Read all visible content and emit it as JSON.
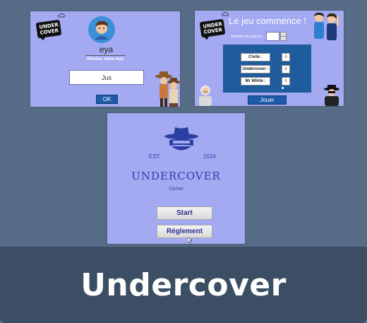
{
  "window1": {
    "logo_text": "UNDER COVER",
    "player_name": "eya",
    "prompt": "Révélez votre mot",
    "word_value": "Jus",
    "ok_label": "OK"
  },
  "window2": {
    "logo_text": "UNDER COVER",
    "heading": "Le jeu commence !",
    "players_label": "Nombre de joueurs :",
    "players_value": "",
    "roles": [
      {
        "label": "Civile :",
        "value": "0"
      },
      {
        "label": "Undercover :",
        "value": "0"
      },
      {
        "label": "Mr White :",
        "value": "0"
      }
    ],
    "play_label": "Jouer"
  },
  "window3": {
    "est_label": "EST.",
    "year": "2024",
    "title": "UNDERCOVER",
    "subtitle": "Game",
    "start_label": "Start",
    "rules_label": "Réglement"
  },
  "footer": {
    "title": "Undercover"
  },
  "colors": {
    "background": "#566b85",
    "window_bg": "#a3aaf2",
    "accent_blue": "#1e5aa8",
    "footer_bg": "#3b4e63",
    "logo_navy": "#2a3ea3"
  }
}
